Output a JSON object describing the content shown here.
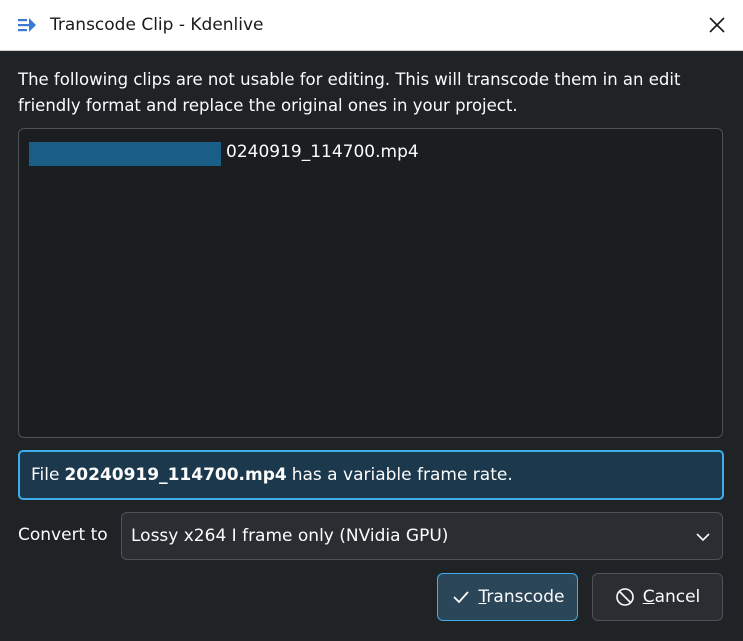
{
  "window": {
    "title": "Transcode Clip - Kdenlive",
    "app_icon": "kdenlive-icon",
    "close_icon": "close-icon"
  },
  "description": "The following clips are not usable for editing. This will transcode them in an edit friendly format and replace the original ones in your project.",
  "clip_list": {
    "items": [
      {
        "name": "0240919_114700.mp4"
      }
    ]
  },
  "message": {
    "prefix": "File",
    "filename": "20240919_114700.mp4",
    "suffix": "has a variable frame rate."
  },
  "convert": {
    "label": "Convert to",
    "selected": "Lossy x264 I frame only (NVidia GPU)"
  },
  "buttons": {
    "transcode": "Transcode",
    "cancel": "Cancel"
  },
  "colors": {
    "accent": "#3daee9",
    "background": "#202326",
    "redaction": "#1a5e87"
  }
}
